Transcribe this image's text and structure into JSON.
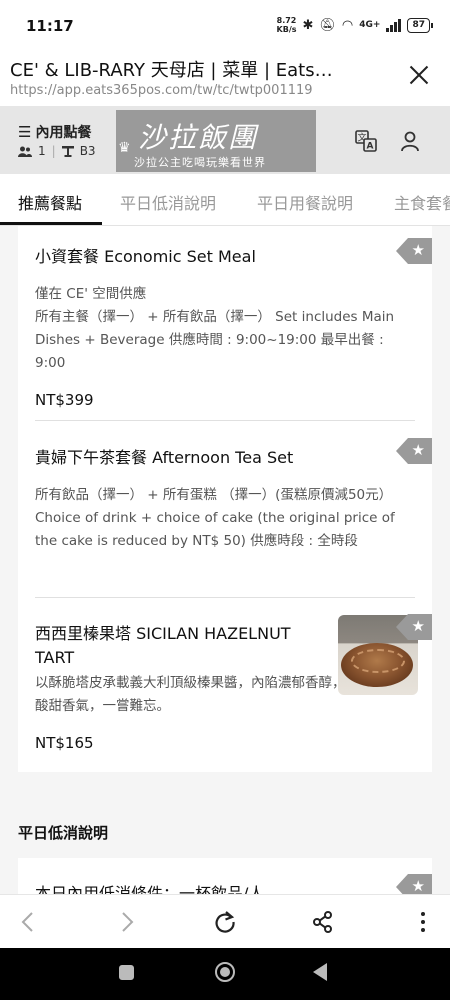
{
  "status": {
    "time": "11:17",
    "speed_value": "8.72",
    "speed_unit": "KB/s",
    "network": "4G+",
    "battery": "87"
  },
  "browser": {
    "title": "CE' & LIB-RARY 天母店 | 菜單 | Eats…",
    "url": "https://app.eats365pos.com/tw/tc/twtp001119"
  },
  "header": {
    "menu_label": "內用點餐",
    "guests": "1",
    "table": "B3",
    "logo_main": "沙拉飯團",
    "logo_sub": "沙拉公主吃喝玩樂看世界"
  },
  "tabs": [
    "推薦餐點",
    "平日低消說明",
    "平日用餐說明",
    "主食套餐"
  ],
  "items": [
    {
      "name": "小資套餐 Economic Set Meal",
      "description": "僅在 CE' 空間供應\n所有主餐（擇一） + 所有飲品（擇一） Set includes Main Dishes + Beverage 供應時間 : 9:00~19:00 最早出餐 : 9:00",
      "price": "NT$399"
    },
    {
      "name": "貴婦下午茶套餐 Afternoon Tea Set",
      "description": "所有飲品（擇一） + 所有蛋糕 （擇一）(蛋糕原價減50元） Choice of drink + choice of cake  (the original price of the cake is reduced by NT$ 50)  供應時段 : 全時段",
      "price": ""
    },
    {
      "name": "西西里榛果塔 SICILAN HAZELNUT TART",
      "description": "以酥脆塔皮承載義大利頂級榛果醬，內陷濃郁香醇，佐以檸檬的酸甜香氣，一嘗難忘。",
      "price": "NT$165"
    }
  ],
  "section2": {
    "title": "平日低消說明",
    "first_item": "本日內用低消條件：一杯飲品/人"
  },
  "colors": {
    "header_bg": "#e6e6e6",
    "logo_bg": "#9a9a9a",
    "tag_bg": "#9a9a9a"
  }
}
